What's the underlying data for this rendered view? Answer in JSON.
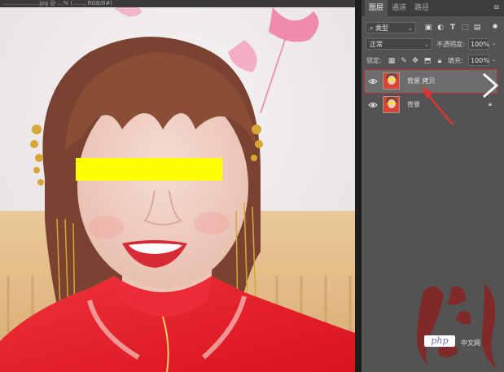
{
  "document": {
    "tab_title": "……………….jpg @ …% (……, RGB/8#)"
  },
  "panel": {
    "tabs": [
      {
        "label": "图层",
        "active": true
      },
      {
        "label": "通道",
        "active": false
      },
      {
        "label": "路径",
        "active": false
      }
    ],
    "filter": {
      "label": "类型"
    },
    "blend_mode": "正常",
    "opacity": {
      "label": "不透明度:",
      "value": "100%"
    },
    "lock": {
      "label": "锁定:"
    },
    "fill": {
      "label": "填充:",
      "value": "100%"
    },
    "layers": [
      {
        "name": "背景 拷贝",
        "selected": true,
        "visible": true,
        "locked": false
      },
      {
        "name": "背景",
        "selected": false,
        "visible": true,
        "locked": true
      }
    ]
  },
  "watermark": {
    "badge": "php",
    "site": "中文网"
  },
  "colors": {
    "accent_red": "#e03232",
    "panel_bg": "#535353",
    "censor_bar": "#ffff00"
  },
  "icons": [
    "visibility-eye-icon",
    "lock-icon",
    "search-filter-icon",
    "panel-menu-icon",
    "chevron-right-icon"
  ]
}
